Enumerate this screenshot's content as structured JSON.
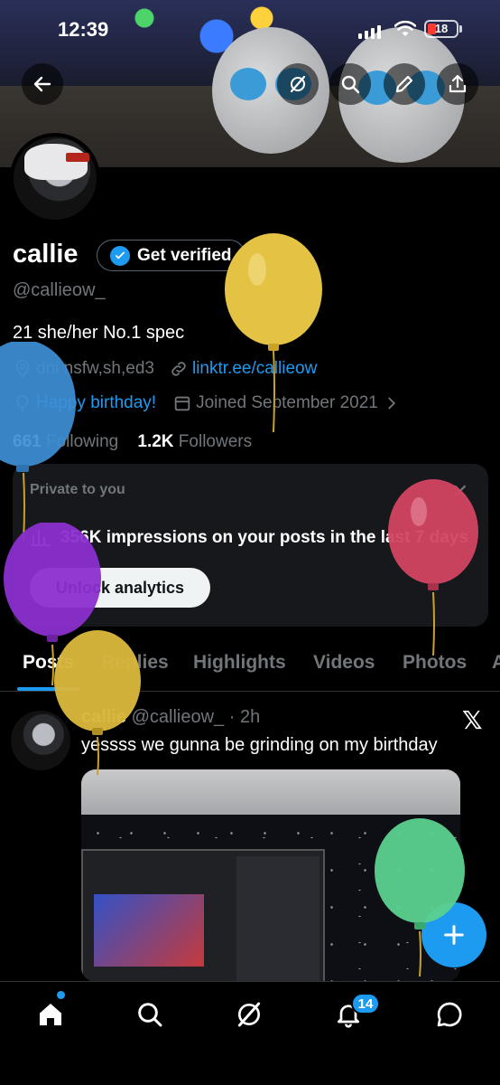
{
  "status_bar": {
    "time": "12:39",
    "battery": "18"
  },
  "header_buttons": [
    "back-icon",
    "grok-icon",
    "search-icon",
    "edit-icon",
    "share-icon"
  ],
  "profile": {
    "name": "callie",
    "verify_label": "Get verified",
    "handle": "@callieow_",
    "bio": "21 she/her No.1 spec",
    "location": "dni nsfw,sh,ed3",
    "link": "linktr.ee/callieow",
    "birthday": "Happy birthday!",
    "joined": "Joined September 2021",
    "following_count": "661",
    "following_label": "Following",
    "followers_count": "1.2K",
    "followers_label": "Followers"
  },
  "private_card": {
    "label": "Private to you",
    "impressions": "356K impressions on your posts in the last 7 days",
    "button": "Unlock analytics"
  },
  "tabs": [
    "Posts",
    "Replies",
    "Highlights",
    "Videos",
    "Photos",
    "A"
  ],
  "post": {
    "name": "callie",
    "handle": "@callieow_",
    "time": "· 2h",
    "text": "yessss we gunna be grinding on my birthday"
  },
  "bottom_nav": {
    "items": [
      "home-icon",
      "search-icon",
      "grok-icon",
      "notifications-icon",
      "messages-icon"
    ],
    "notification_count": "14"
  },
  "colors": {
    "accent": "#1d9bf0",
    "background": "#000000",
    "muted": "#71767b"
  }
}
